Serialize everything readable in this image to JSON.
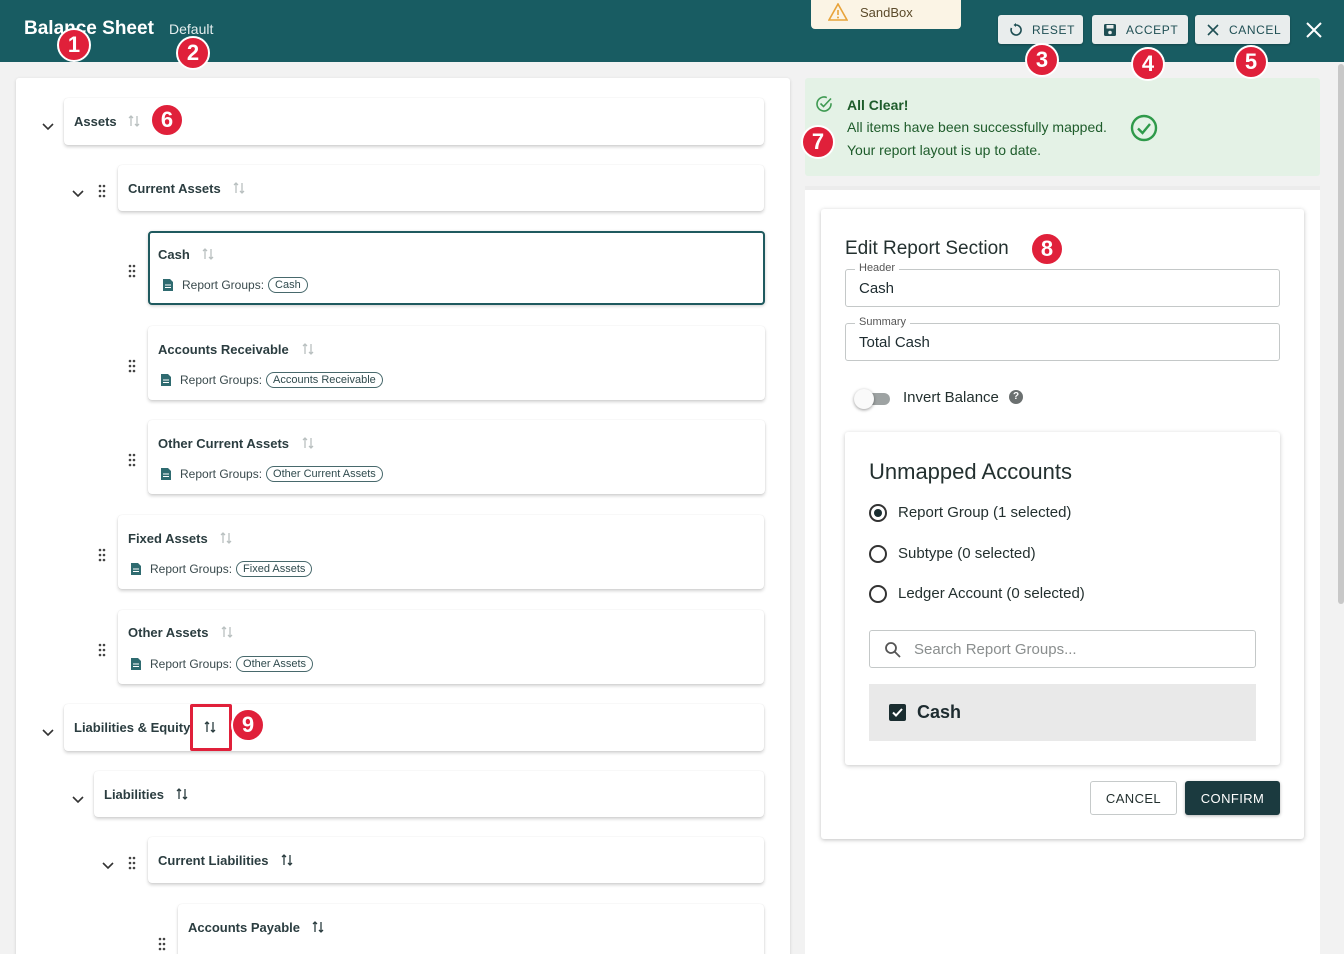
{
  "header": {
    "title": "Balance Sheet",
    "subtitle": "Default",
    "sandbox_label": "SandBox",
    "reset_label": "RESET",
    "accept_label": "ACCEPT",
    "cancel_label": "CANCEL"
  },
  "markers": [
    "1",
    "2",
    "3",
    "4",
    "5",
    "6",
    "7",
    "8",
    "9"
  ],
  "tree": {
    "assets": "Assets",
    "current_assets": "Current Assets",
    "cash": "Cash",
    "accounts_receivable": "Accounts Receivable",
    "other_current_assets": "Other Current Assets",
    "fixed_assets": "Fixed Assets",
    "other_assets": "Other Assets",
    "liabilities_equity": "Liabilities & Equity",
    "liabilities": "Liabilities",
    "current_liabilities": "Current Liabilities",
    "accounts_payable": "Accounts Payable",
    "report_groups_label": "Report Groups:",
    "chips": {
      "cash": "Cash",
      "accounts_receivable": "Accounts Receivable",
      "other_current_assets": "Other Current Assets",
      "fixed_assets": "Fixed Assets",
      "other_assets": "Other Assets"
    }
  },
  "alert": {
    "title": "All Clear!",
    "line1": "All items have been successfully mapped.",
    "line2": "Your report layout is up to date."
  },
  "edit": {
    "title": "Edit Report Section",
    "header_label": "Header",
    "header_value": "Cash",
    "summary_label": "Summary",
    "summary_value": "Total Cash",
    "invert_label": "Invert Balance",
    "help": "?",
    "unmapped_title": "Unmapped Accounts",
    "radio_report_group": "Report Group (1 selected)",
    "radio_subtype": "Subtype (0 selected)",
    "radio_ledger": "Ledger Account (0 selected)",
    "search_placeholder": "Search Report Groups...",
    "selected_item": "Cash",
    "cancel_label": "CANCEL",
    "confirm_label": "CONFIRM"
  },
  "colors": {
    "header_bg": "#185c62",
    "marker": "#e0203a",
    "alert_bg": "#e4f2e6",
    "confirm_bg": "#1b3a3f"
  }
}
